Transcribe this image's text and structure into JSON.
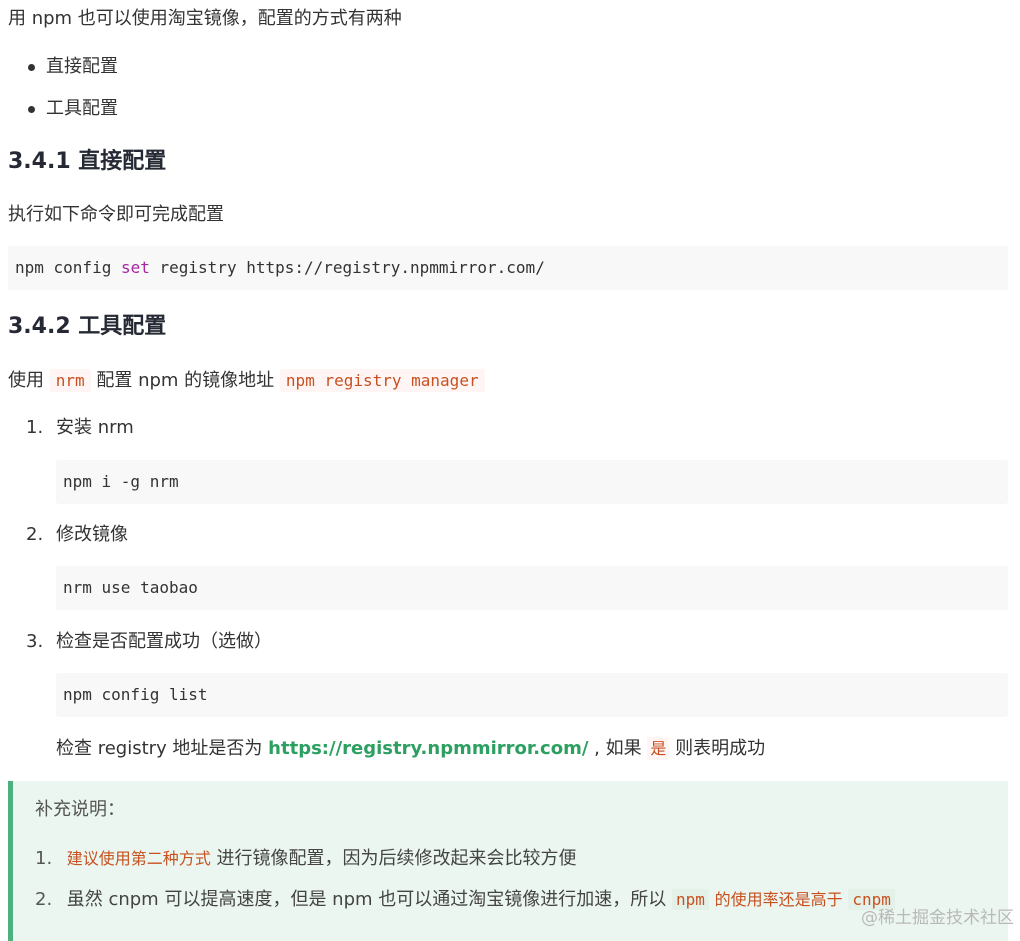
{
  "intro": "用 npm 也可以使用淘宝镜像，配置的方式有两种",
  "bullets": [
    "直接配置",
    "工具配置"
  ],
  "section1": {
    "heading": "3.4.1 直接配置",
    "text": "执行如下命令即可完成配置",
    "code": {
      "cmd": "npm config ",
      "kw": "set",
      "rest": " registry https://registry.npmmirror.com/"
    }
  },
  "section2": {
    "heading": "3.4.2 工具配置",
    "line_pre": "使用",
    "line_code1": "nrm",
    "line_mid": "配置 npm 的镜像地址",
    "line_code2": "npm registry manager",
    "steps": [
      {
        "num": "1.",
        "text": "安装 nrm",
        "code": "npm i -g nrm"
      },
      {
        "num": "2.",
        "text": "修改镜像",
        "code": "nrm use taobao"
      },
      {
        "num": "3.",
        "text": "检查是否配置成功（选做）",
        "code": "npm config list"
      }
    ],
    "check": {
      "pre": "检查 registry 地址是否为",
      "link": "https://registry.npmmirror.com/",
      "mid": ", 如果",
      "code": "是",
      "post": "则表明成功"
    }
  },
  "note": {
    "title": "补充说明：",
    "items": [
      {
        "num": "1.",
        "red": "建议使用第二种方式",
        "text": "进行镜像配置，因为后续修改起来会比较方便"
      },
      {
        "num": "2.",
        "text": "虽然 cnpm 可以提高速度，但是 npm 也可以通过淘宝镜像进行加速，所以",
        "c1": "npm",
        "red": "的使用率还是高于",
        "c2": "cnpm"
      }
    ]
  },
  "watermark": "@稀土掘金技术社区"
}
